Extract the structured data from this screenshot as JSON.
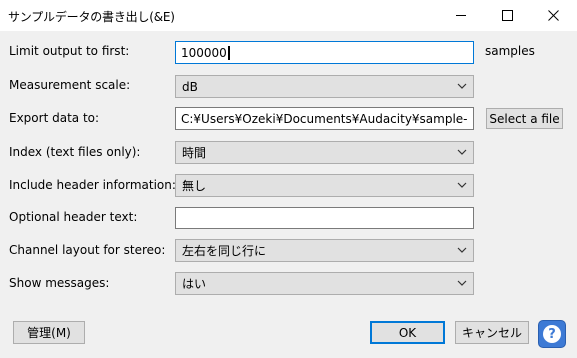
{
  "window": {
    "title": "サンプルデータの書き出し(&E)"
  },
  "form": {
    "limit_output": {
      "label": "Limit output to first:",
      "value": "100000",
      "unit": "samples"
    },
    "measurement_scale": {
      "label": "Measurement scale:",
      "value": "dB"
    },
    "export_to": {
      "label": "Export data to:",
      "value": "C:¥Users¥Ozeki¥Documents¥Audacity¥sample-data.txt",
      "button": "Select a file"
    },
    "index": {
      "label": "Index (text files only):",
      "value": "時間"
    },
    "header_info": {
      "label": "Include header information:",
      "value": "無し"
    },
    "header_text": {
      "label": "Optional header text:",
      "value": ""
    },
    "channel_layout": {
      "label": "Channel layout for stereo:",
      "value": "左右を同じ行に"
    },
    "show_messages": {
      "label": "Show messages:",
      "value": "はい"
    }
  },
  "footer": {
    "manage": "管理(M)",
    "ok": "OK",
    "cancel": "キャンセル",
    "help": "?"
  }
}
